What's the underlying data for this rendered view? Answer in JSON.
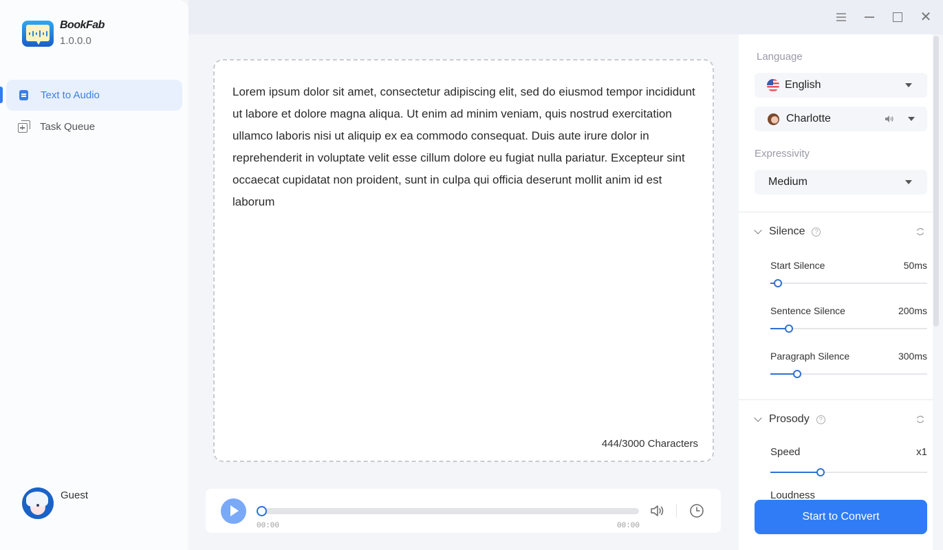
{
  "app": {
    "name": "BookFab",
    "version": "1.0.0.0"
  },
  "sidebar": {
    "items": [
      {
        "label": "Text to Audio",
        "icon": "document-icon",
        "active": true
      },
      {
        "label": "Task Queue",
        "icon": "task-queue-icon",
        "active": false
      }
    ],
    "user": {
      "name": "Guest"
    }
  },
  "titlebar": {
    "buttons": [
      "menu-icon",
      "minimize-icon",
      "maximize-icon",
      "close-icon"
    ],
    "close_glyph": "✕"
  },
  "editor": {
    "text": "Lorem ipsum dolor sit amet, consectetur adipiscing elit, sed do eiusmod tempor incididunt ut labore et dolore magna aliqua. Ut enim ad minim veniam, quis nostrud exercitation ullamco laboris nisi ut aliquip ex ea commodo consequat. Duis aute irure dolor in reprehenderit in voluptate velit esse cillum dolore eu fugiat nulla pariatur. Excepteur sint occaecat cupidatat non proident, sunt in culpa qui officia deserunt mollit anim id est laborum",
    "char_count": "444/3000 Characters"
  },
  "player": {
    "current_time": "00:00",
    "total_time": "00:00",
    "progress": 0
  },
  "settings": {
    "language_label": "Language",
    "language_value": "English",
    "voice_value": "Charlotte",
    "expressivity_label": "Expressivity",
    "expressivity_value": "Medium",
    "silence": {
      "title": "Silence",
      "help_glyph": "?",
      "sliders": [
        {
          "label": "Start Silence",
          "value": "50ms",
          "fraction": 0.05
        },
        {
          "label": "Sentence Silence",
          "value": "200ms",
          "fraction": 0.12
        },
        {
          "label": "Paragraph Silence",
          "value": "300ms",
          "fraction": 0.17
        }
      ]
    },
    "prosody": {
      "title": "Prosody",
      "help_glyph": "?",
      "sliders": [
        {
          "label": "Speed",
          "value": "x1",
          "fraction": 0.32
        },
        {
          "label": "Loudness",
          "value": "",
          "fraction": null
        }
      ]
    },
    "convert_label": "Start to Convert"
  },
  "colors": {
    "accent": "#2f7cf6",
    "active_nav_bg": "#e8f0fd",
    "play_button": "#7aa9f7"
  }
}
